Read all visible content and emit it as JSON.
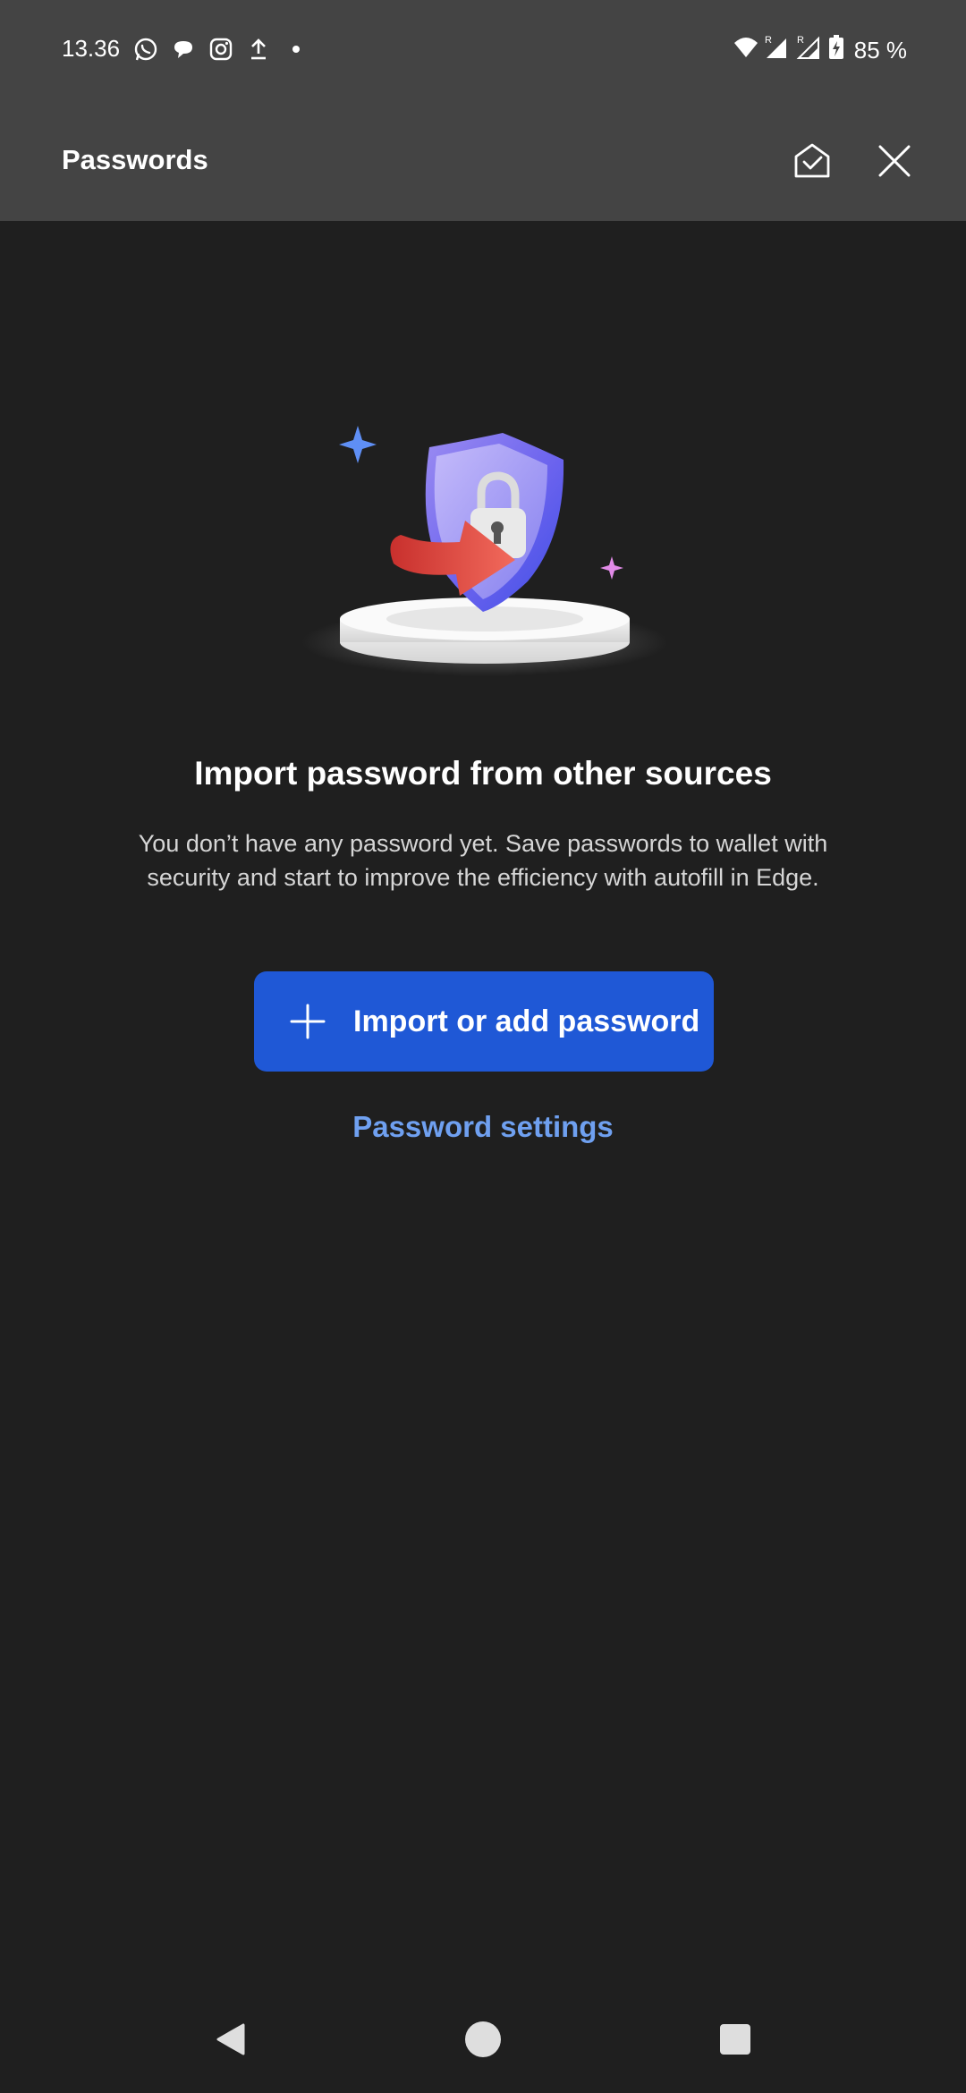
{
  "status_bar": {
    "time": "13.36",
    "battery": "85 %",
    "left_icons": [
      "whatsapp-icon",
      "chat-bubble-icon",
      "instagram-icon",
      "upload-icon",
      "dot-icon"
    ],
    "right_icons": [
      "wifi-icon",
      "signal-roaming-icon",
      "signal-roaming-icon",
      "battery-charging-icon"
    ]
  },
  "app_bar": {
    "title": "Passwords",
    "actions": [
      "home-check-icon",
      "close-icon"
    ]
  },
  "empty_state": {
    "heading": "Import password from other sources",
    "description": "You don’t have any password yet. Save passwords to wallet with security and start to improve the efficiency with autofill in Edge.",
    "primary_button": "Import or add password",
    "secondary_link": "Password settings"
  },
  "nav_bar": {
    "buttons": [
      "back-icon",
      "home-icon",
      "recents-icon"
    ]
  },
  "colors": {
    "background": "#1f1f1f",
    "bar": "#444444",
    "accent": "#1f58d6",
    "link": "#6fa0f0"
  }
}
